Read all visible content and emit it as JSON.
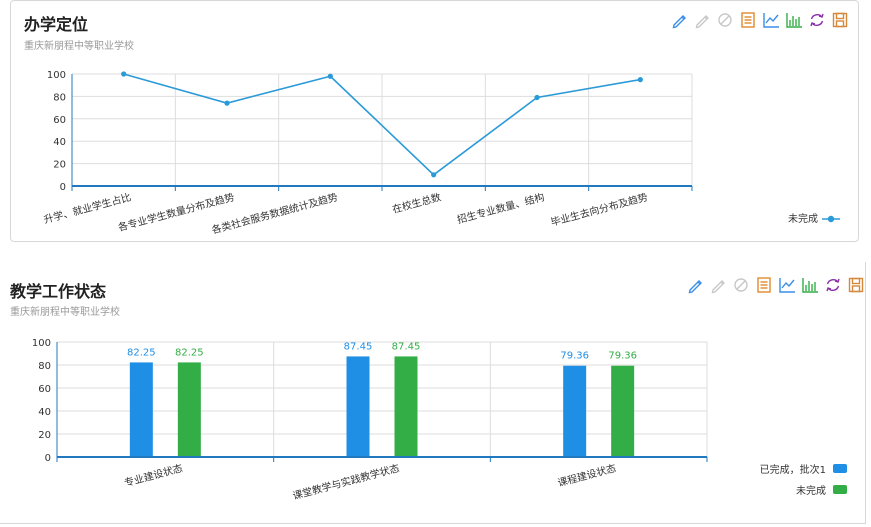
{
  "panel1": {
    "title": "办学定位",
    "subtitle": "重庆新朋程中等职业学校",
    "toolbar": [
      "edit-icon",
      "edit-disabled-icon",
      "reset-icon",
      "data-view-icon",
      "line-chart-icon",
      "bar-chart-icon",
      "refresh-icon",
      "save-icon"
    ]
  },
  "panel2": {
    "title": "教学工作状态",
    "subtitle": "重庆新朋程中等职业学校",
    "toolbar": [
      "edit-icon",
      "edit-disabled-icon",
      "reset-icon",
      "data-view-icon",
      "line-chart-icon",
      "bar-chart-icon",
      "refresh-icon",
      "save-icon"
    ]
  },
  "colors": {
    "line": "#2a9ad8",
    "blue": "#1f8fe6",
    "green": "#33ad45",
    "axis": "#1f78c0",
    "grid": "#dddddd"
  },
  "chart_data": [
    {
      "type": "line",
      "categories": [
        "升学、就业学生占比",
        "各专业学生数量分布及趋势",
        "各类社会服务数据统计及趋势",
        "在校生总数",
        "招生专业数量、结构",
        "毕业生去向分布及趋势"
      ],
      "series": [
        {
          "name": "未完成",
          "values": [
            100,
            74,
            98,
            10,
            79,
            95
          ]
        }
      ],
      "yticks": [
        0,
        20,
        40,
        60,
        80,
        100
      ],
      "ylim": [
        0,
        100
      ],
      "grid": true,
      "legend": "bottom-right"
    },
    {
      "type": "bar",
      "categories": [
        "专业建设状态",
        "课堂教学与实践教学状态",
        "课程建设状态"
      ],
      "series": [
        {
          "name": "已完成，批次1",
          "values": [
            82.25,
            87.45,
            79.36
          ],
          "labels": [
            "82.25",
            "87.45",
            "79.36"
          ]
        },
        {
          "name": "未完成",
          "values": [
            82.25,
            87.45,
            79.36
          ],
          "labels": [
            "82.25",
            "87.45",
            "79.36"
          ]
        }
      ],
      "yticks": [
        0,
        20,
        40,
        60,
        80,
        100
      ],
      "ylim": [
        0,
        100
      ],
      "grid": true,
      "legend": "bottom-right"
    }
  ]
}
